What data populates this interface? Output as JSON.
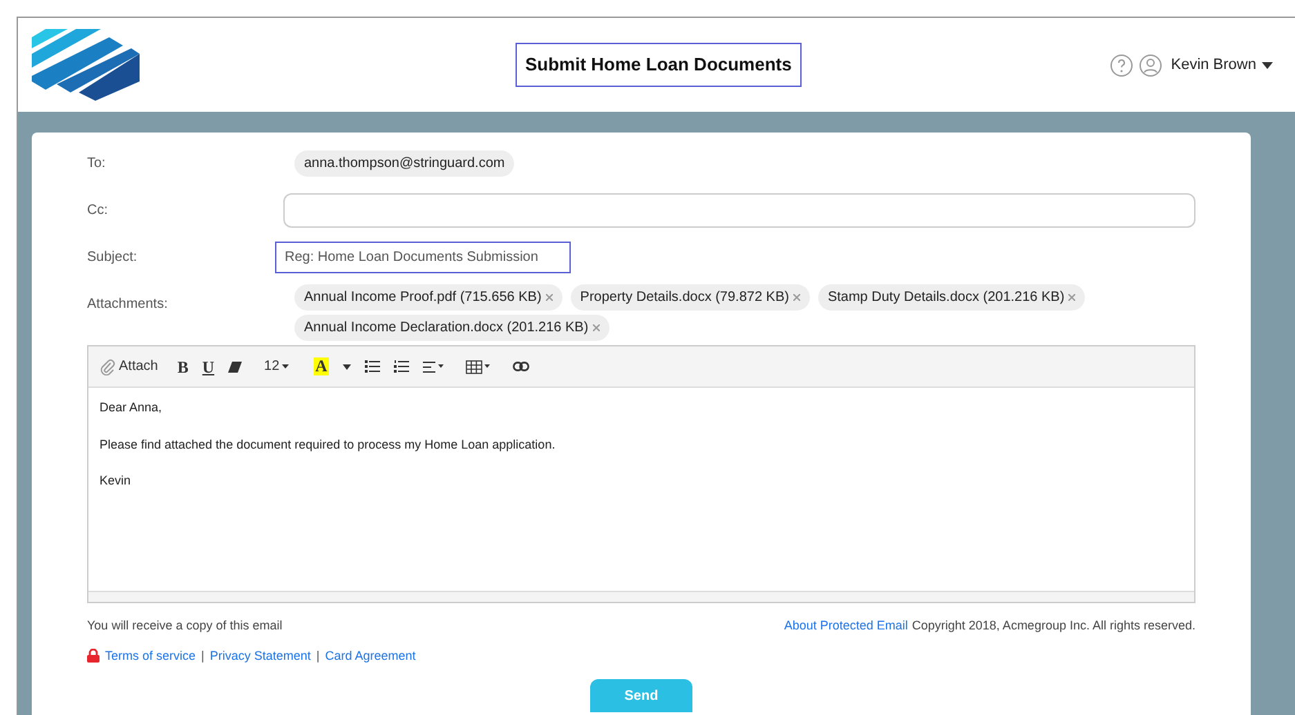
{
  "header": {
    "title": "Submit Home Loan Documents",
    "user": "Kevin Brown"
  },
  "form": {
    "to_label": "To:",
    "to": "anna.thompson@stringuard.com",
    "cc_label": "Cc:",
    "subject_label": "Subject:",
    "subject": "Reg: Home Loan Documents Submission",
    "attachments_label": "Attachments:",
    "attachments": [
      {
        "name": "Annual Income Proof.pdf (715.656 KB)"
      },
      {
        "name": "Property Details.docx (79.872 KB)"
      },
      {
        "name": "Stamp Duty Details.docx (201.216 KB)"
      },
      {
        "name": "Annual Income Declaration.docx (201.216 KB)"
      }
    ]
  },
  "toolbar": {
    "attach": "Attach",
    "bold": "B",
    "underline": "U",
    "font_size": "12",
    "highlight": "A"
  },
  "body": [
    "Dear Anna,",
    "Please find attached the document required to process my Home Loan application.",
    "Kevin"
  ],
  "footer": {
    "copy_note": "You will receive a copy of this email",
    "about_link": "About Protected Email",
    "copyright": "Copyright 2018, Acmegroup Inc. All rights reserved.",
    "links": [
      "Terms of service",
      "Privacy Statement",
      "Card Agreement"
    ],
    "separator": "|"
  },
  "send": "Send"
}
